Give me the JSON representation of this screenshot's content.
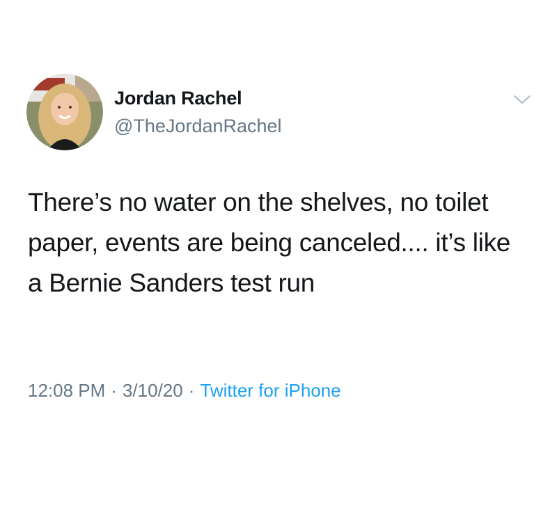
{
  "tweet": {
    "author": {
      "display_name": "Jordan Rachel",
      "handle": "@TheJordanRachel",
      "avatar": "profile-photo"
    },
    "text": "There’s no water on the shelves, no toilet paper, events are being canceled.... it’s like a Bernie Sanders test run",
    "time": "12:08 PM",
    "date": "3/10/20",
    "source": "Twitter for iPhone",
    "separator": "·",
    "menu_icon": "chevron-down-icon"
  },
  "colors": {
    "text": "#14171a",
    "secondary": "#657786",
    "link": "#1da1f2",
    "background": "#ffffff"
  }
}
